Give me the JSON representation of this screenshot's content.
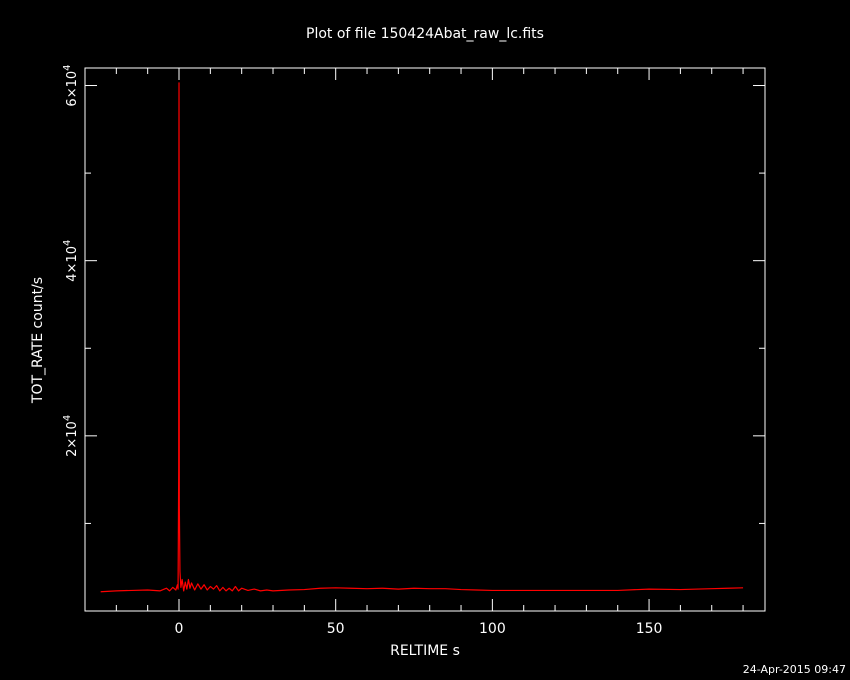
{
  "chart_data": {
    "type": "line",
    "title": "Plot of file 150424Abat_raw_lc.fits",
    "xlabel": "RELTIME  s",
    "ylabel": "TOT_RATE  count/s",
    "timestamp": "24-Apr-2015 09:47",
    "xlim": [
      -30,
      187
    ],
    "ylim": [
      0,
      62000
    ],
    "x_ticks": [
      0,
      50,
      100,
      150
    ],
    "x_tick_labels": [
      "0",
      "50",
      "100",
      "150"
    ],
    "y_ticks": [
      20000,
      40000,
      60000
    ],
    "y_tick_mantissas": [
      "2",
      "4",
      "6"
    ],
    "y_tick_base": "×10",
    "y_tick_exponent": "4",
    "colors": {
      "series": "#ff0000",
      "axes": "#ffffff",
      "background": "#000000"
    },
    "series": [
      {
        "values": [
          [
            -25,
            2200
          ],
          [
            -20,
            2300
          ],
          [
            -15,
            2350
          ],
          [
            -10,
            2400
          ],
          [
            -6,
            2300
          ],
          [
            -4,
            2600
          ],
          [
            -3,
            2300
          ],
          [
            -2,
            2700
          ],
          [
            -1,
            2400
          ],
          [
            -0.5,
            3000
          ],
          [
            -0.3,
            2500
          ],
          [
            -0.1,
            16000
          ],
          [
            0,
            60300
          ],
          [
            0.1,
            12000
          ],
          [
            0.3,
            4500
          ],
          [
            0.6,
            2700
          ],
          [
            1,
            3600
          ],
          [
            1.5,
            2300
          ],
          [
            2,
            3300
          ],
          [
            2.5,
            2500
          ],
          [
            3,
            3600
          ],
          [
            3.5,
            2600
          ],
          [
            4,
            3200
          ],
          [
            5,
            2400
          ],
          [
            6,
            3100
          ],
          [
            7,
            2500
          ],
          [
            8,
            3000
          ],
          [
            9,
            2400
          ],
          [
            10,
            2800
          ],
          [
            11,
            2500
          ],
          [
            12,
            2900
          ],
          [
            13,
            2300
          ],
          [
            14,
            2700
          ],
          [
            15,
            2300
          ],
          [
            16,
            2600
          ],
          [
            17,
            2300
          ],
          [
            18,
            2800
          ],
          [
            19,
            2300
          ],
          [
            20,
            2600
          ],
          [
            22,
            2350
          ],
          [
            24,
            2500
          ],
          [
            26,
            2300
          ],
          [
            28,
            2400
          ],
          [
            30,
            2300
          ],
          [
            35,
            2400
          ],
          [
            40,
            2450
          ],
          [
            45,
            2600
          ],
          [
            50,
            2650
          ],
          [
            55,
            2600
          ],
          [
            60,
            2550
          ],
          [
            65,
            2600
          ],
          [
            70,
            2500
          ],
          [
            75,
            2600
          ],
          [
            80,
            2550
          ],
          [
            85,
            2550
          ],
          [
            90,
            2450
          ],
          [
            95,
            2400
          ],
          [
            100,
            2350
          ],
          [
            110,
            2350
          ],
          [
            120,
            2350
          ],
          [
            130,
            2350
          ],
          [
            140,
            2350
          ],
          [
            150,
            2500
          ],
          [
            160,
            2450
          ],
          [
            170,
            2550
          ],
          [
            175,
            2600
          ],
          [
            180,
            2650
          ]
        ]
      }
    ]
  }
}
